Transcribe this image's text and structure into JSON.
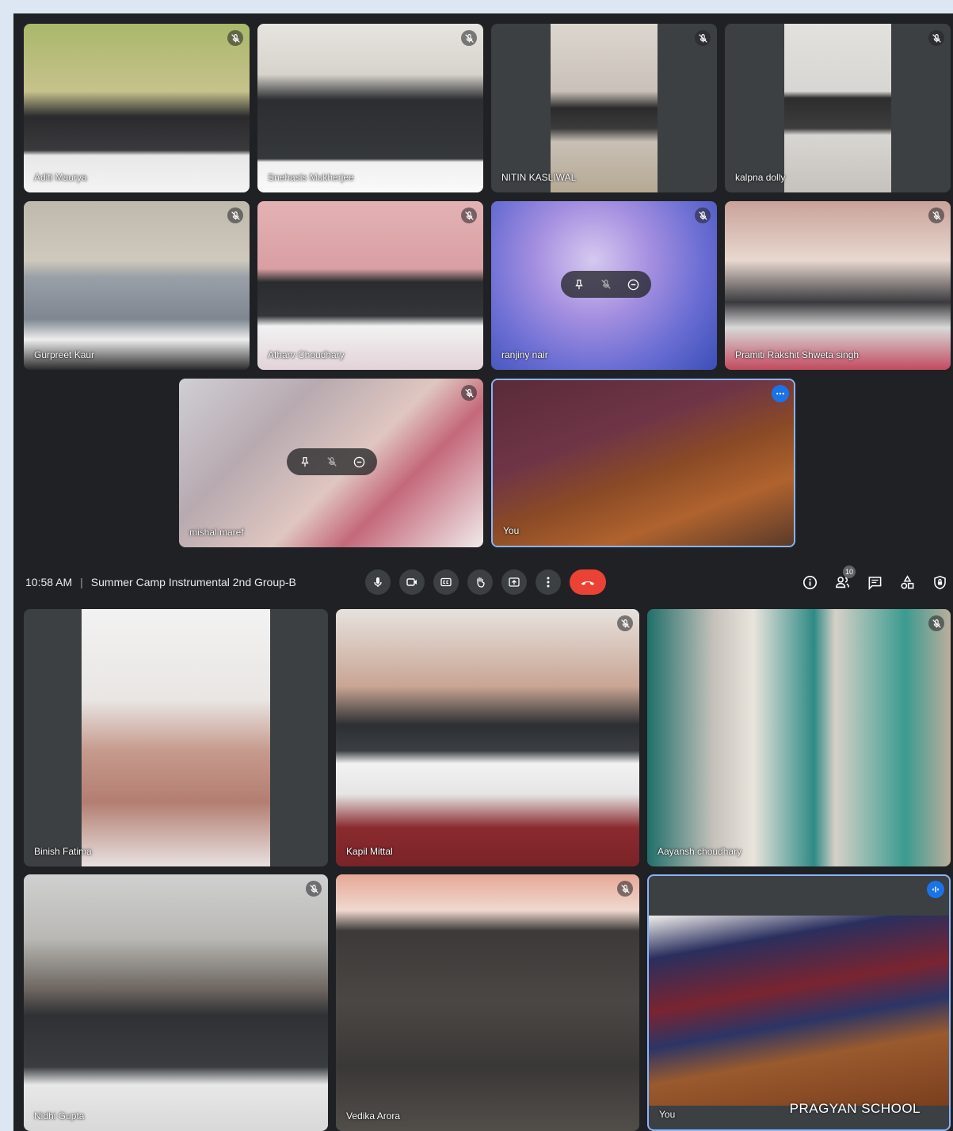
{
  "meeting": {
    "time": "10:58 AM",
    "separator": "|",
    "title": "Summer Camp Instrumental 2nd Group-B",
    "participant_count": "10"
  },
  "top_grid": [
    {
      "name": "Aditi Maurya",
      "muted": true
    },
    {
      "name": "Snehasis Mukherjee",
      "muted": true
    },
    {
      "name": "NITIN KASLIWAL",
      "muted": true
    },
    {
      "name": "kalpna dolly",
      "muted": true
    },
    {
      "name": "Gurpreet Kaur",
      "muted": true
    },
    {
      "name": "Atharv Choudhary",
      "muted": true
    },
    {
      "name": "ranjiny nair",
      "muted": true
    },
    {
      "name": "Pramiti Rakshit Shweta singh",
      "muted": true
    },
    {
      "name": "mishal maref",
      "muted": true
    },
    {
      "name": "You",
      "muted": false
    }
  ],
  "bottom_grid": [
    {
      "name": "Binish Fatima",
      "muted": false
    },
    {
      "name": "Kapil Mittal",
      "muted": true
    },
    {
      "name": "Aayansh choudhary",
      "muted": true
    },
    {
      "name": "Nidhi Gupta",
      "muted": true
    },
    {
      "name": "Vedika Arora",
      "muted": true
    },
    {
      "name": "You",
      "muted": false
    }
  ],
  "watermark": "PRAGYAN SCHOOL",
  "controls": {
    "center": [
      "microphone-icon",
      "camera-icon",
      "captions-icon",
      "raise-hand-icon",
      "present-icon",
      "more-options-icon",
      "end-call-icon"
    ],
    "right": [
      "info-icon",
      "people-icon",
      "chat-icon",
      "activities-icon",
      "host-controls-icon"
    ]
  },
  "colors": {
    "background": "#202124",
    "outer": "#dde6f3",
    "end_call": "#ea4335",
    "active_border": "#8ab4f8",
    "accent": "#1a73e8"
  }
}
